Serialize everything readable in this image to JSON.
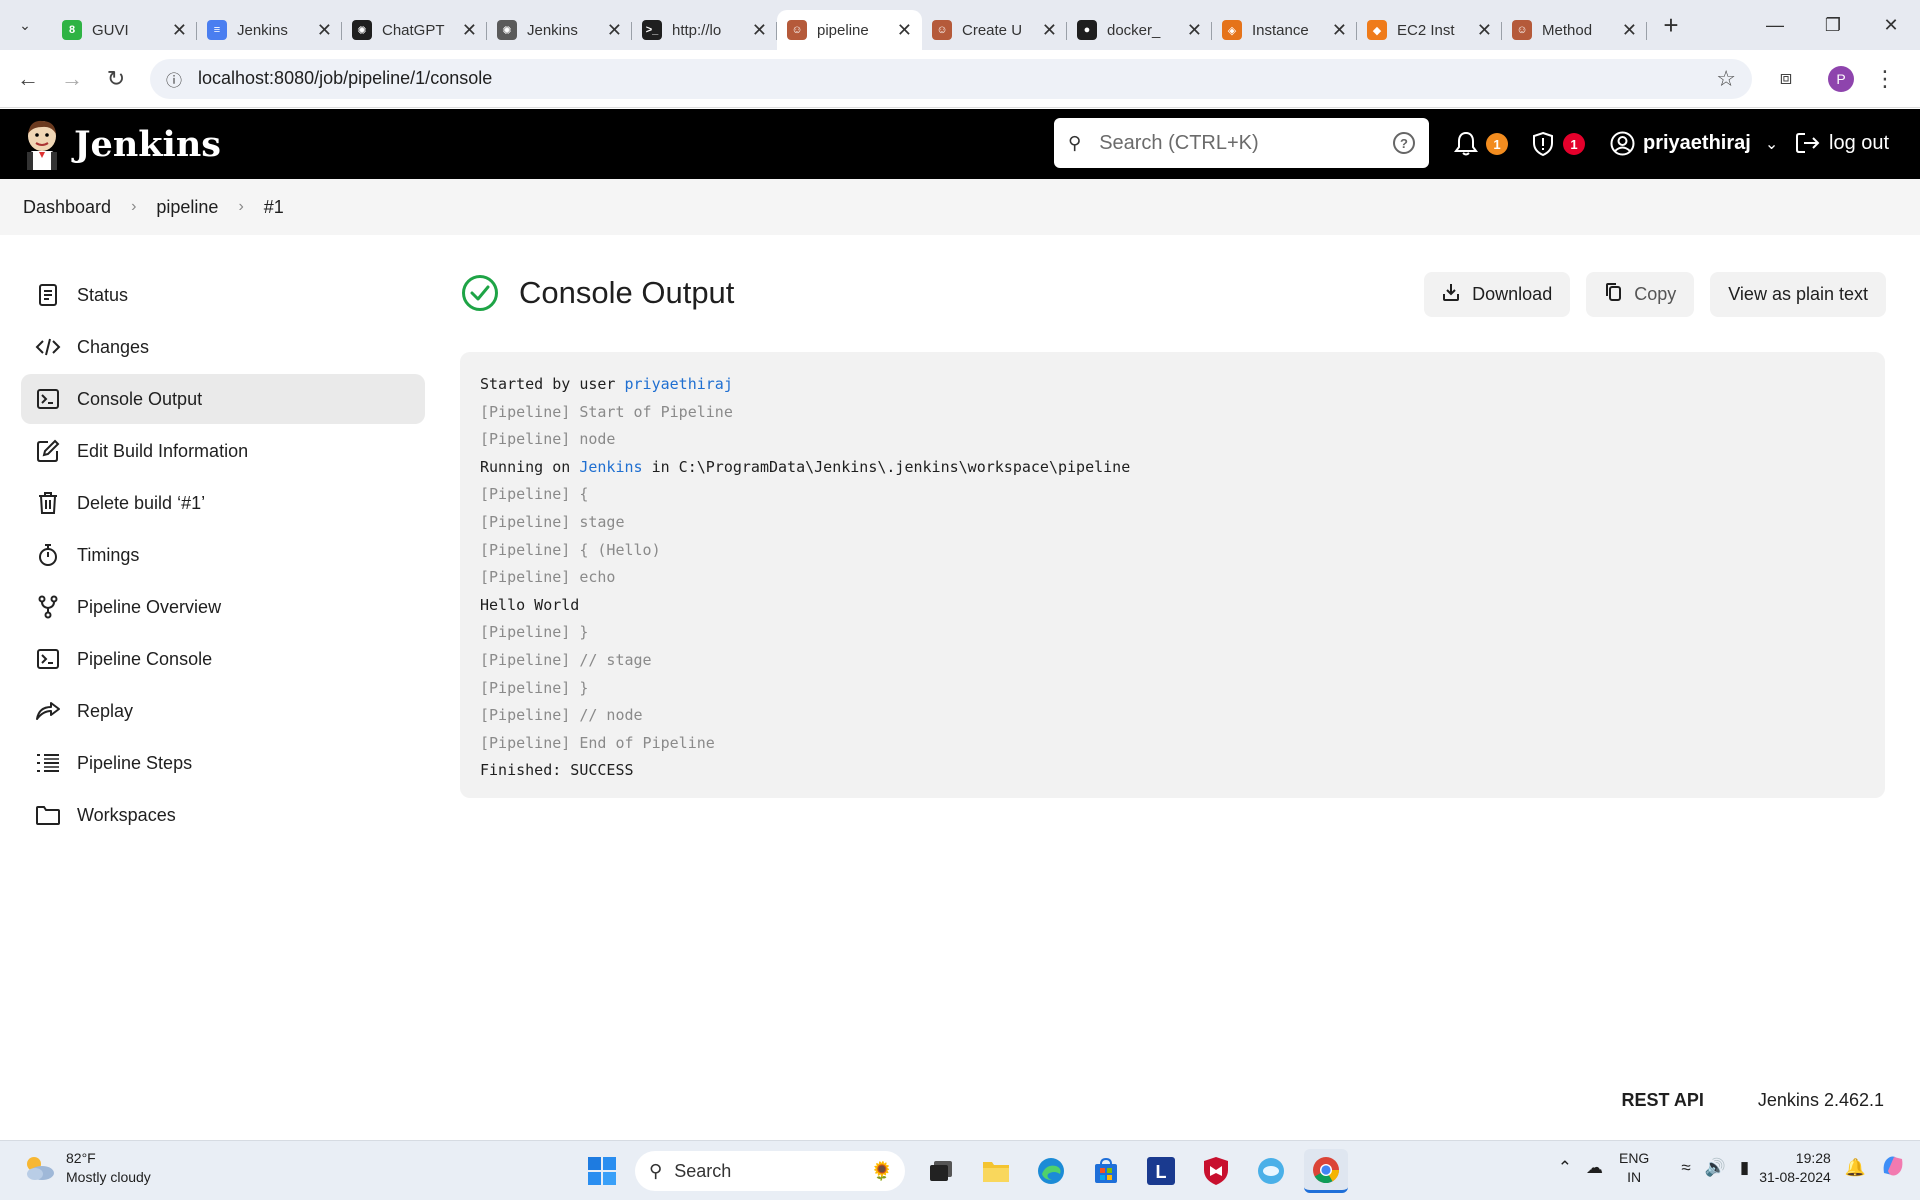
{
  "browser": {
    "tabs": [
      {
        "title": "GUVI",
        "fav": "8",
        "fav_color": "#2fb344"
      },
      {
        "title": "Jenkins",
        "fav": "≡",
        "fav_color": "#4a7ef0"
      },
      {
        "title": "ChatGPT",
        "fav": "✺",
        "fav_color": "#1f1f1f"
      },
      {
        "title": "Jenkins",
        "fav": "✺",
        "fav_color": "#5a5a5a"
      },
      {
        "title": "http://lo",
        "fav": ">_",
        "fav_color": "#1f1f1f"
      },
      {
        "title": "pipeline",
        "fav": "☺",
        "fav_color": "#b55a3a"
      },
      {
        "title": "Create U",
        "fav": "☺",
        "fav_color": "#b55a3a"
      },
      {
        "title": "docker_",
        "fav": "●",
        "fav_color": "#1f1f1f"
      },
      {
        "title": "Instance",
        "fav": "◈",
        "fav_color": "#e5731a"
      },
      {
        "title": "EC2 Inst",
        "fav": "◆",
        "fav_color": "#ef7b1a"
      },
      {
        "title": "Method",
        "fav": "☺",
        "fav_color": "#b55a3a"
      }
    ],
    "active_tab_index": 5,
    "url": "localhost:8080/job/pipeline/1/console",
    "profile_initial": "P"
  },
  "header": {
    "brand": "Jenkins",
    "search_placeholder": "Search (CTRL+K)",
    "notifications_count": "1",
    "security_count": "1",
    "username": "priyaethiraj",
    "logout_label": "log out",
    "notif_color": "#f28c1f",
    "security_color": "#e4002b"
  },
  "breadcrumb": [
    "Dashboard",
    "pipeline",
    "#1"
  ],
  "sidebar": {
    "items": [
      {
        "label": "Status",
        "icon": "document-icon"
      },
      {
        "label": "Changes",
        "icon": "code-icon"
      },
      {
        "label": "Console Output",
        "icon": "terminal-icon"
      },
      {
        "label": "Edit Build Information",
        "icon": "edit-icon"
      },
      {
        "label": "Delete build ‘#1’",
        "icon": "trash-icon"
      },
      {
        "label": "Timings",
        "icon": "stopwatch-icon"
      },
      {
        "label": "Pipeline Overview",
        "icon": "branch-icon"
      },
      {
        "label": "Pipeline Console",
        "icon": "terminal-icon"
      },
      {
        "label": "Replay",
        "icon": "replay-icon"
      },
      {
        "label": "Pipeline Steps",
        "icon": "list-icon"
      },
      {
        "label": "Workspaces",
        "icon": "folder-icon"
      }
    ],
    "active_index": 2
  },
  "main": {
    "title": "Console Output",
    "status_color": "#1ea446",
    "download_label": "Download",
    "copy_label": "Copy",
    "plain_text_label": "View as plain text"
  },
  "console": {
    "lines": [
      {
        "style": "norm",
        "parts": [
          {
            "t": "Started by user "
          },
          {
            "t": "priyaethiraj",
            "link": true
          }
        ]
      },
      {
        "style": "dim",
        "parts": [
          {
            "t": "[Pipeline] Start of Pipeline"
          }
        ]
      },
      {
        "style": "dim",
        "parts": [
          {
            "t": "[Pipeline] node"
          }
        ]
      },
      {
        "style": "norm",
        "parts": [
          {
            "t": "Running on "
          },
          {
            "t": "Jenkins",
            "link": true
          },
          {
            "t": " in C:\\ProgramData\\Jenkins\\.jenkins\\workspace\\pipeline"
          }
        ]
      },
      {
        "style": "dim",
        "parts": [
          {
            "t": "[Pipeline] {"
          }
        ]
      },
      {
        "style": "dim",
        "parts": [
          {
            "t": "[Pipeline] stage"
          }
        ]
      },
      {
        "style": "dim",
        "parts": [
          {
            "t": "[Pipeline] { (Hello)"
          }
        ]
      },
      {
        "style": "dim",
        "parts": [
          {
            "t": "[Pipeline] echo"
          }
        ]
      },
      {
        "style": "norm",
        "parts": [
          {
            "t": "Hello World"
          }
        ]
      },
      {
        "style": "dim",
        "parts": [
          {
            "t": "[Pipeline] }"
          }
        ]
      },
      {
        "style": "dim",
        "parts": [
          {
            "t": "[Pipeline] // stage"
          }
        ]
      },
      {
        "style": "dim",
        "parts": [
          {
            "t": "[Pipeline] }"
          }
        ]
      },
      {
        "style": "dim",
        "parts": [
          {
            "t": "[Pipeline] // node"
          }
        ]
      },
      {
        "style": "dim",
        "parts": [
          {
            "t": "[Pipeline] End of Pipeline"
          }
        ]
      },
      {
        "style": "norm",
        "parts": [
          {
            "t": "Finished: SUCCESS"
          }
        ]
      }
    ]
  },
  "footer": {
    "rest_api": "REST API",
    "version": "Jenkins 2.462.1"
  },
  "taskbar": {
    "temperature": "82°F",
    "weather": "Mostly cloudy",
    "search_label": "Search",
    "lang_top": "ENG",
    "lang_bottom": "IN",
    "time": "19:28",
    "date": "31-08-2024"
  }
}
